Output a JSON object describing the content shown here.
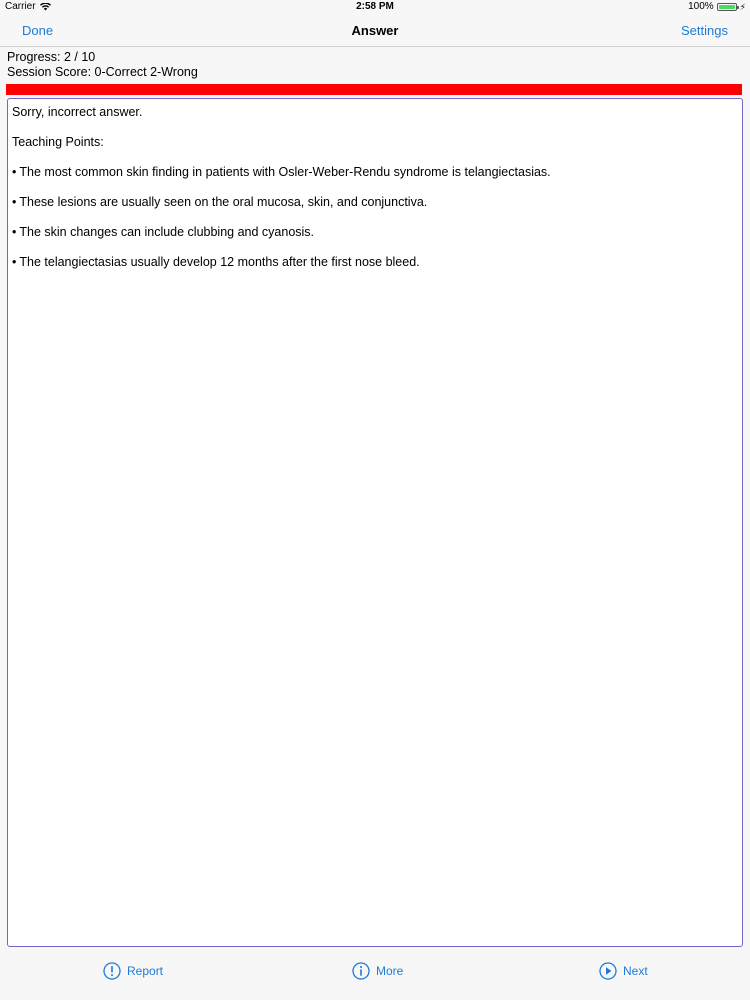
{
  "status_bar": {
    "carrier": "Carrier",
    "time": "2:58 PM",
    "battery": "100%",
    "battery_level": 1.0,
    "battery_color": "#4cd964"
  },
  "nav": {
    "left_label": "Done",
    "title": "Answer",
    "right_label": "Settings",
    "tint_color": "#1f7ad6"
  },
  "progress": {
    "progress_text": "Progress: 2 / 10",
    "score_text": "Session Score: 0-Correct 2-Wrong",
    "bar_fraction": 1.0,
    "bar_color": "#ff0000"
  },
  "answer": {
    "result": "Sorry, incorrect answer.",
    "heading": "Teaching Points:",
    "bullet_char": "•",
    "points": [
      "The most common skin finding in patients with Osler-Weber-Rendu syndrome is telangiectasias.",
      "These lesions are usually seen on the oral mucosa, skin, and conjunctiva.",
      "The skin changes can include clubbing and cyanosis.",
      "The telangiectasias usually develop 12 months after the first nose bleed."
    ]
  },
  "toolbar": {
    "report_label": "Report",
    "report_icon": "exclamation-circle-icon",
    "more_label": "More",
    "more_icon": "info-circle-icon",
    "next_label": "Next",
    "next_icon": "play-circle-icon"
  }
}
